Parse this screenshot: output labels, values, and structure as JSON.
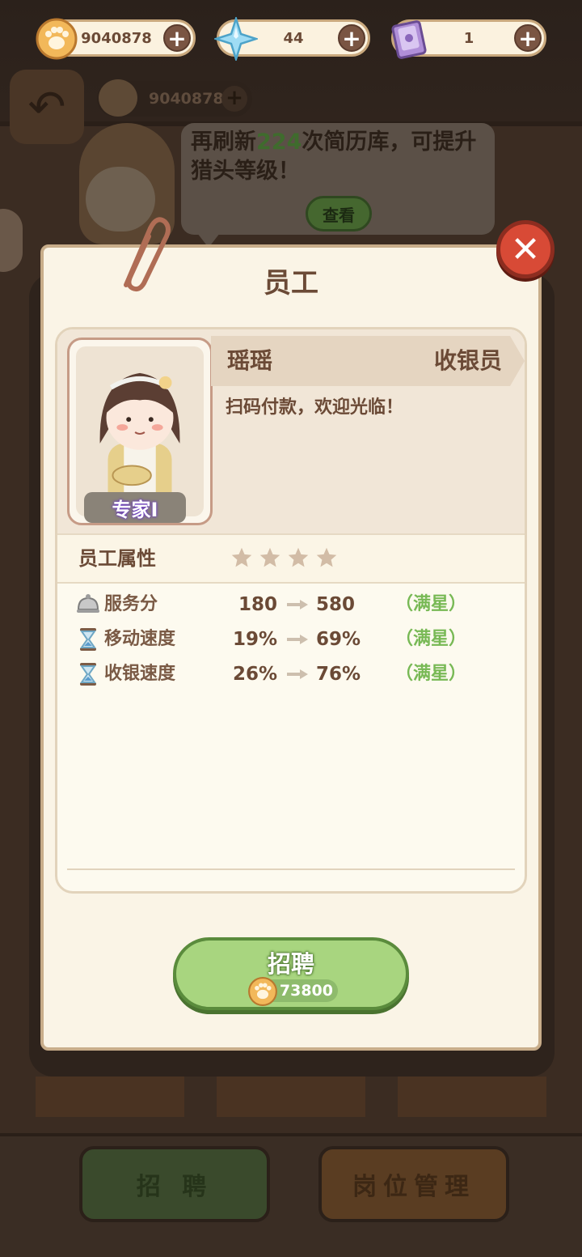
{
  "currencies": {
    "paw_coins": "9040878",
    "gems": "44",
    "books": "1"
  },
  "background": {
    "coin_display": "9040878",
    "tabs": {
      "recruit": "招 聘",
      "manage": "岗位管理"
    }
  },
  "bubble": {
    "msg_before": "再刷新",
    "count": "224",
    "msg_after": "次简历库，可提升猎头等级！",
    "view_button": "查看"
  },
  "modal": {
    "title": "员工",
    "employee": {
      "name": "瑶瑶",
      "role": "收银员",
      "slogan": "扫码付款，欢迎光临！",
      "rank": "专家I"
    },
    "attributes_label": "员工属性",
    "stars": 4,
    "stats": [
      {
        "icon": "cloche-icon",
        "label": "服务分",
        "from": "180",
        "to": "580",
        "note": "（满星）"
      },
      {
        "icon": "hourglass-icon",
        "label": "移动速度",
        "from": "19%",
        "to": "69%",
        "note": "（满星）"
      },
      {
        "icon": "hourglass-icon",
        "label": "收银速度",
        "from": "26%",
        "to": "76%",
        "note": "（满星）"
      }
    ],
    "hire_button": {
      "label": "招聘",
      "cost": "73800"
    }
  },
  "colors": {
    "accent_green": "#a8d57f",
    "close_red": "#d84a36",
    "text_brown": "#6b4a36",
    "max_green": "#78b955"
  }
}
